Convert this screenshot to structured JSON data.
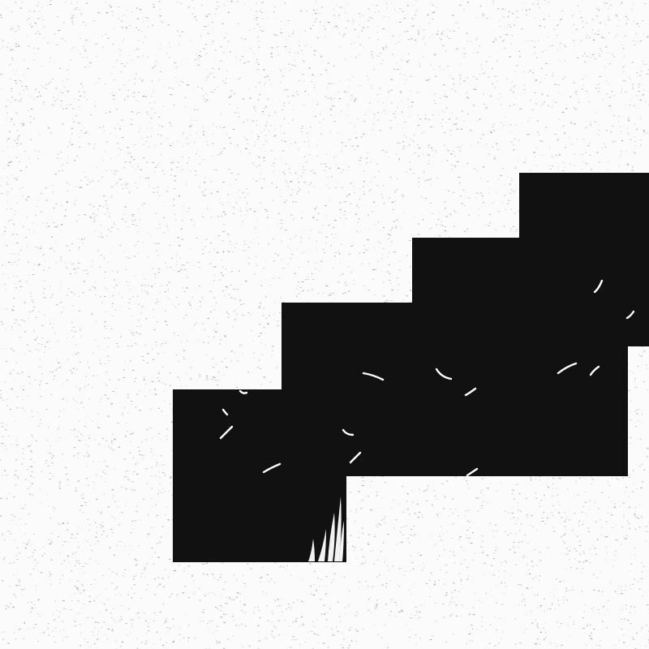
{
  "image": {
    "background_color": "#fbfbfb",
    "noise_color": "#9a9a9a",
    "dark_color": "#111111",
    "mark_color": "#ffffff"
  }
}
